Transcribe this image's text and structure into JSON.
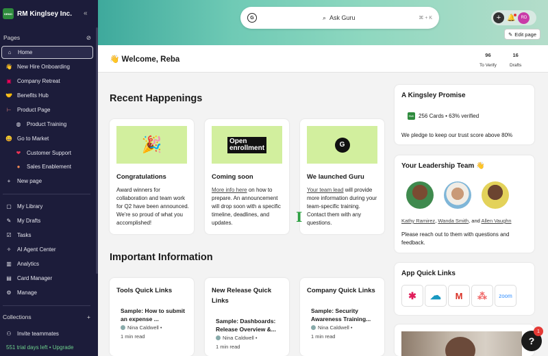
{
  "sidebar": {
    "org": {
      "logo": "DEMO",
      "name": "RM Kinglsey Inc.",
      "collapse_icon": "«"
    },
    "pages_label": "Pages",
    "pages": [
      {
        "icon": "⌂",
        "label": "Home"
      },
      {
        "icon": "👋",
        "label": "New Hire Onboarding"
      },
      {
        "icon": "▣",
        "label": "Company Retreat"
      },
      {
        "icon": "🤝",
        "label": "Benefits Hub"
      },
      {
        "icon": "⊢",
        "label": "Product Page"
      },
      {
        "icon": "◍",
        "label": "Product Training"
      },
      {
        "icon": "😀",
        "label": "Go to Market"
      },
      {
        "icon": "❤",
        "label": "Customer Support"
      },
      {
        "icon": "●",
        "label": "Sales Enablement"
      },
      {
        "icon": "+",
        "label": "New page"
      }
    ],
    "tools": [
      {
        "icon": "▢",
        "label": "My Library"
      },
      {
        "icon": "✎",
        "label": "My Drafts"
      },
      {
        "icon": "☑",
        "label": "Tasks"
      },
      {
        "icon": "✧",
        "label": "AI Agent Center"
      },
      {
        "icon": "▥",
        "label": "Analytics"
      },
      {
        "icon": "▤",
        "label": "Card Manager"
      },
      {
        "icon": "⚙",
        "label": "Manage"
      }
    ],
    "collections_label": "Collections",
    "collections_add": "+",
    "invite": {
      "icon": "⚇",
      "label": "Invite teammates"
    },
    "trial": "551 trial days left • Upgrade"
  },
  "topbar": {
    "search_placeholder": "Ask Guru",
    "search_shortcut": "⌘ + K",
    "avatar_initials": "RD",
    "edit_page": "Edit page"
  },
  "welcome": {
    "text": "👋 Welcome, Reba",
    "to_verify_count": "96",
    "to_verify_label": "To Verify",
    "drafts_count": "16",
    "drafts_label": "Drafts"
  },
  "recent": {
    "title": "Recent Happenings",
    "cards": [
      {
        "title": "Congratulations",
        "body": "Award winners for collaboration and team work for Q2 have been announced.  We're so proud of what you accomplished!"
      },
      {
        "title": "Coming soon",
        "link": "More info here",
        "body": " on how to prepare. An announcement will drop soon with a specific timeline, deadlines, and updates.",
        "hero_line1": "Open",
        "hero_line2": "enrollment"
      },
      {
        "title": "We launched Guru",
        "link": "Your team lead",
        "body": " will provide more information during your team-specific training. Contact them with any questions."
      }
    ]
  },
  "important": {
    "title": "Important Information",
    "cards": [
      {
        "title": "Tools Quick Links",
        "sub": "Sample: How to submit an expense ...",
        "author": "Nina Caldwell •",
        "time": "1 min read"
      },
      {
        "title": "New Release Quick Links",
        "sub": "Sample: Dashboards: Release Overview &...",
        "author": "Nina Caldwell •",
        "time": "1 min read"
      },
      {
        "title": "Company Quick Links",
        "sub": "Sample: Security Awareness Training...",
        "author": "Nina Caldwell •",
        "time": "1 min read"
      }
    ]
  },
  "promise": {
    "title": "A Kingsley Promise",
    "badge": "RMK",
    "stats": "256 Cards • 63% verified",
    "text": "We pledge to keep our trust score above 80%"
  },
  "leadership": {
    "title": "Your Leadership Team 👋",
    "names": [
      "Kathy Ramirez",
      ", ",
      "Wanda Smith",
      ", and ",
      "Allen Vaughn"
    ],
    "text": "Please reach out to them with questions and feedback."
  },
  "apps": {
    "title": "App Quick Links",
    "tiles": [
      {
        "name": "slack",
        "glyph": "✱",
        "color": "#e01e5a"
      },
      {
        "name": "salesforce",
        "glyph": "☁",
        "color": "#1798c1"
      },
      {
        "name": "gmail",
        "glyph": "M",
        "color": "#d93025"
      },
      {
        "name": "asana",
        "glyph": "⁂",
        "color": "#f06a6a"
      },
      {
        "name": "zoom",
        "glyph": "zoom",
        "color": "#2d8cff"
      }
    ]
  },
  "help": {
    "label": "?",
    "badge": "1"
  }
}
